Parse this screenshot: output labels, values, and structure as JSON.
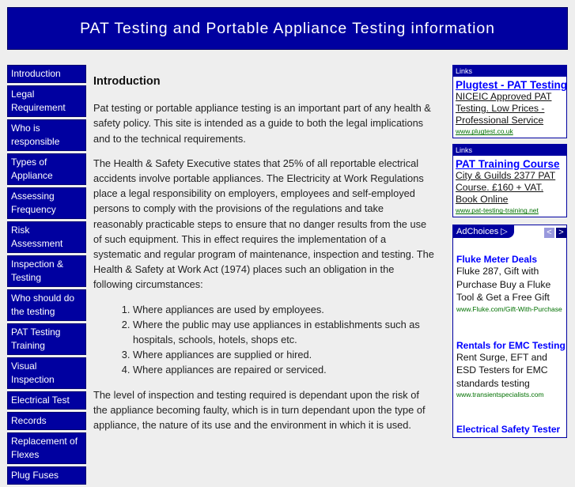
{
  "header": {
    "title": "PAT Testing and Portable Appliance Testing information"
  },
  "nav": [
    "Introduction",
    "Legal Requirement",
    "Who is responsible",
    "Types of Appliance",
    "Assessing Frequency",
    "Risk Assessment",
    "Inspection & Testing",
    "Who should do the testing",
    "PAT Testing Training",
    "Visual Inspection",
    "Electrical Test",
    "Records",
    "Replacement of Flexes",
    "Plug Fuses"
  ],
  "main": {
    "heading": "Introduction",
    "p1": "Pat testing or portable appliance testing is an important part of any health & safety policy. This site is intended as a guide to both the legal implications and to the technical requirements.",
    "p2": "The Health & Safety Executive states that 25% of all reportable electrical accidents involve portable appliances. The Electricity at Work Regulations place a legal responsibility on employers, employees and self-employed persons to comply with the provisions of the regulations and take reasonably practicable steps to ensure that no danger results from the use of such equipment. This in effect requires the implementation of a systematic and regular program of maintenance, inspection and testing. The Health & Safety at Work Act (1974) places such an obligation in the following circumstances:",
    "list": [
      "Where appliances are used by employees.",
      "Where the public may use appliances in establishments such as hospitals, schools, hotels, shops etc.",
      "Where appliances are supplied or hired.",
      "Where appliances are repaired or serviced."
    ],
    "p3": "The level of inspection and testing required is dependant upon the risk of the appliance becoming faulty, which is in turn dependant upon the type of appliance, the nature of its use and the environment in which it is used."
  },
  "ads": [
    {
      "header": "Links",
      "title": "Plugtest - PAT Testing",
      "desc": "NICEIC Approved PAT Testing. Low Prices - Professional Service",
      "url": "www.plugtest.co.uk"
    },
    {
      "header": "Links",
      "title": "PAT Training Course",
      "desc": "City & Guilds 2377 PAT Course. £160 + VAT. Book Online",
      "url": "www.pat-testing-training.net"
    }
  ],
  "adchoices": {
    "label": "AdChoices",
    "prev": "<",
    "next": ">",
    "items": [
      {
        "title": "Fluke Meter Deals",
        "desc": "Fluke 287, Gift with Purchase Buy a Fluke Tool & Get a Free Gift",
        "url": "www.Fluke.com/Gift-With-Purchase"
      },
      {
        "title": "Rentals for EMC Testing",
        "desc": "Rent Surge, EFT and ESD Testers for EMC standards testing",
        "url": "www.transientspecialists.com"
      },
      {
        "title": "Electrical Safety Tester",
        "desc": "",
        "url": ""
      }
    ]
  }
}
